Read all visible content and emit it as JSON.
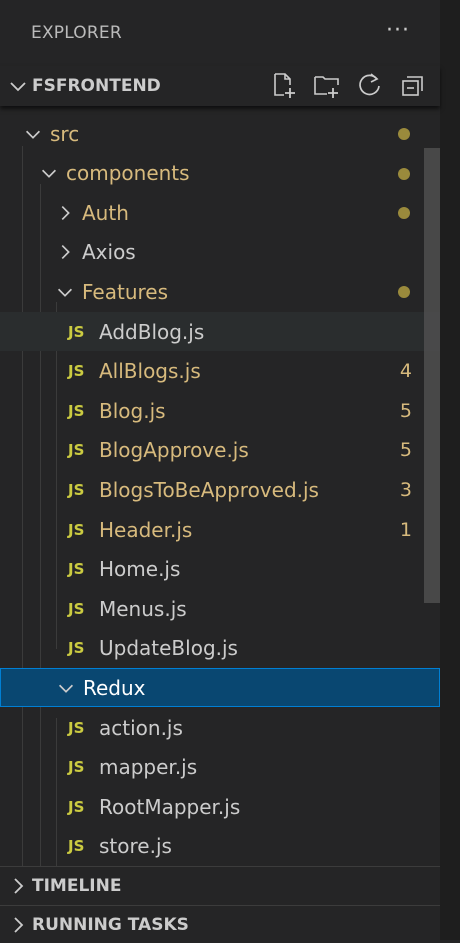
{
  "explorer": {
    "title": "EXPLORER",
    "more": "···"
  },
  "root": {
    "label": "FSFRONTEND"
  },
  "tree": [
    {
      "label": "src",
      "kind": "folder",
      "open": true,
      "modified": true
    },
    {
      "label": "components",
      "kind": "folder",
      "open": true,
      "modified": true
    },
    {
      "label": "Auth",
      "kind": "folder",
      "open": false,
      "modified": true
    },
    {
      "label": "Axios",
      "kind": "folder",
      "open": false,
      "modified": false
    },
    {
      "label": "Features",
      "kind": "folder",
      "open": true,
      "modified": true
    },
    {
      "label": "AddBlog.js",
      "kind": "file",
      "icon": "JS",
      "modified": false
    },
    {
      "label": "AllBlogs.js",
      "kind": "file",
      "icon": "JS",
      "modified": true,
      "count": "4"
    },
    {
      "label": "Blog.js",
      "kind": "file",
      "icon": "JS",
      "modified": true,
      "count": "5"
    },
    {
      "label": "BlogApprove.js",
      "kind": "file",
      "icon": "JS",
      "modified": true,
      "count": "5"
    },
    {
      "label": "BlogsToBeApproved.js",
      "kind": "file",
      "icon": "JS",
      "modified": true,
      "count": "3"
    },
    {
      "label": "Header.js",
      "kind": "file",
      "icon": "JS",
      "modified": true,
      "count": "1"
    },
    {
      "label": "Home.js",
      "kind": "file",
      "icon": "JS",
      "modified": false
    },
    {
      "label": "Menus.js",
      "kind": "file",
      "icon": "JS",
      "modified": false
    },
    {
      "label": "UpdateBlog.js",
      "kind": "file",
      "icon": "JS",
      "modified": false
    },
    {
      "label": "Redux",
      "kind": "folder",
      "open": true,
      "modified": false
    },
    {
      "label": "action.js",
      "kind": "file",
      "icon": "JS",
      "modified": false
    },
    {
      "label": "mapper.js",
      "kind": "file",
      "icon": "JS",
      "modified": false
    },
    {
      "label": "RootMapper.js",
      "kind": "file",
      "icon": "JS",
      "modified": false
    },
    {
      "label": "store.js",
      "kind": "file",
      "icon": "JS",
      "modified": false
    }
  ],
  "sections": {
    "timeline": "TIMELINE",
    "running": "RUNNING TASKS"
  },
  "colors": {
    "modified": "#d7ba7d",
    "js": "#cbcb41",
    "selected": "#094771",
    "selectedBorder": "#007fd4"
  }
}
